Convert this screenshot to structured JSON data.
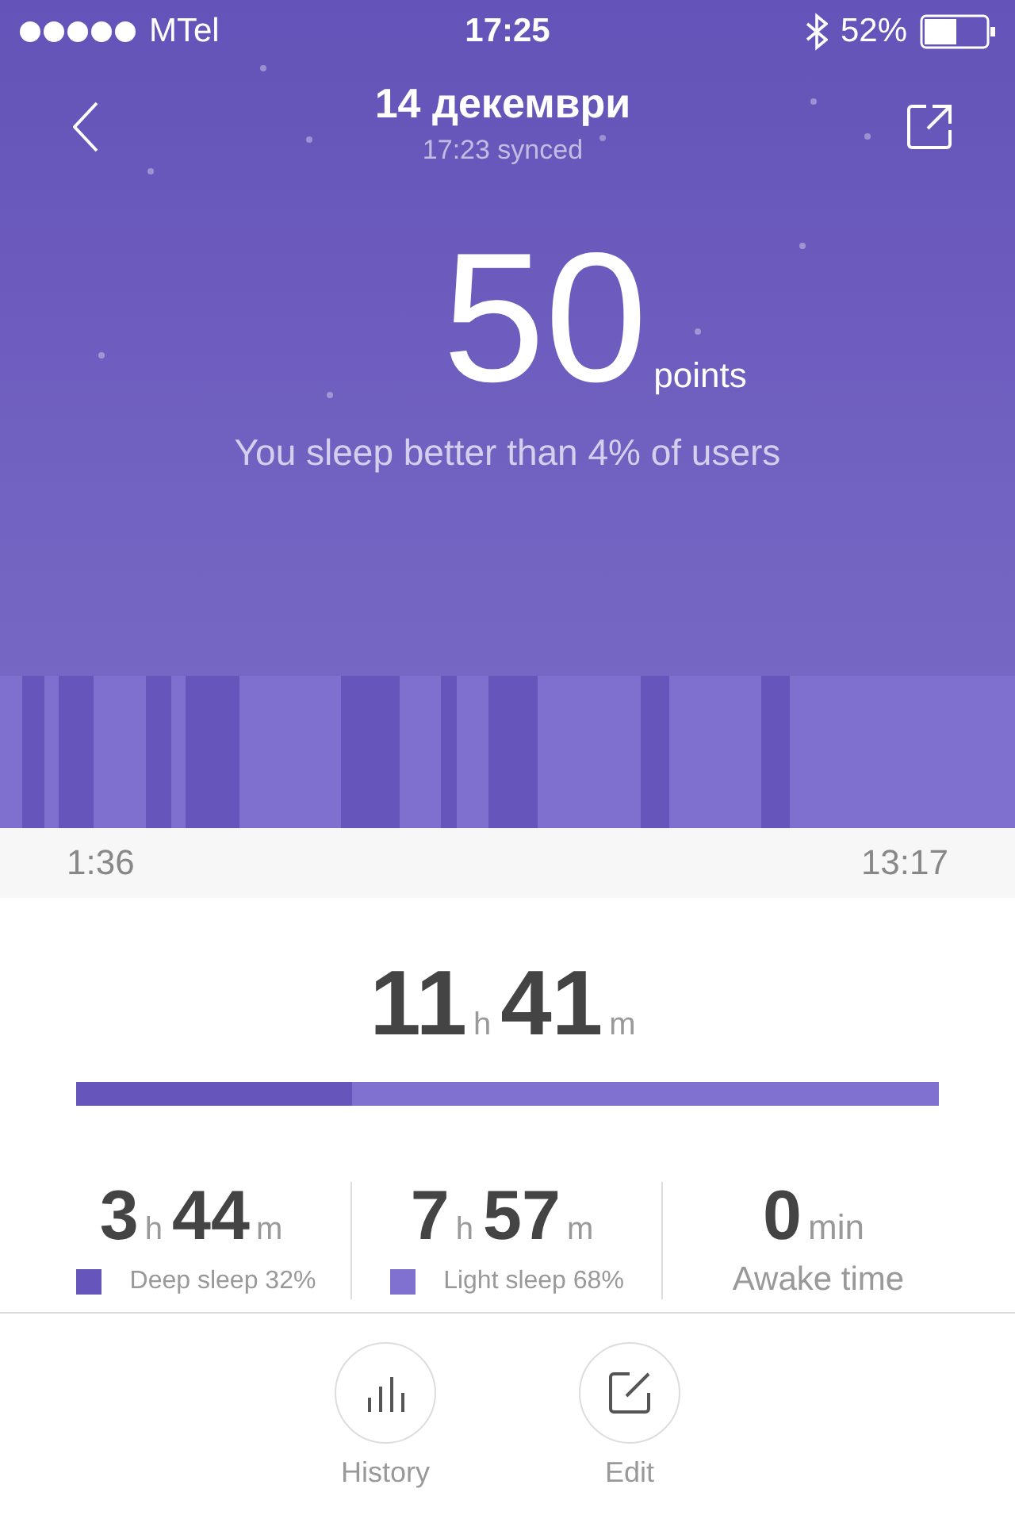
{
  "status_bar": {
    "carrier": "MTel",
    "time": "17:25",
    "battery": "52%"
  },
  "header": {
    "title": "14 декември",
    "subtitle": "17:23 synced"
  },
  "score": {
    "value": "50",
    "unit": "points",
    "caption": "You sleep better than 4% of users"
  },
  "timeline": {
    "start": "1:36",
    "end": "13:17"
  },
  "total": {
    "hours": "11",
    "hours_unit": "h",
    "minutes": "41",
    "minutes_unit": "m",
    "level": 0.32
  },
  "stats": [
    {
      "kind": "duration",
      "hours": "3",
      "hours_unit": "h",
      "minutes": "44",
      "minutes_unit": "m",
      "label": "Deep sleep 32%",
      "color": "#6655bb"
    },
    {
      "kind": "duration",
      "hours": "7",
      "hours_unit": "h",
      "minutes": "57",
      "minutes_unit": "m",
      "label": "Light sleep 68%",
      "color": "#8070d0"
    },
    {
      "kind": "single",
      "value": "0",
      "unit": "min",
      "label": "Awake time"
    }
  ],
  "actions": [
    {
      "kind": "history",
      "label": "History"
    },
    {
      "kind": "edit",
      "label": "Edit"
    }
  ]
}
